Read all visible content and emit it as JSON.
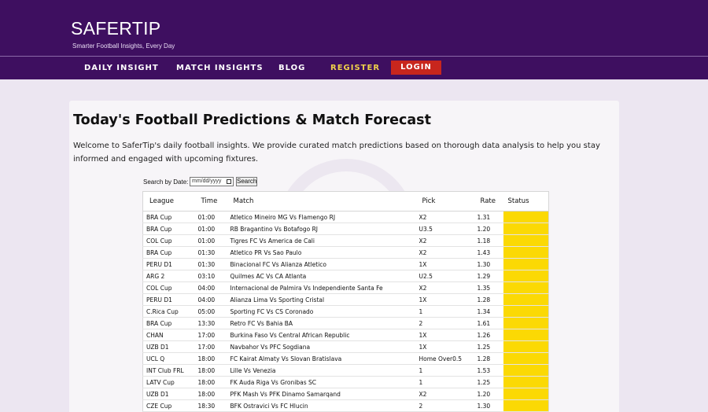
{
  "header": {
    "brand": "SAFERTIP",
    "tagline": "Smarter Football Insights, Every Day"
  },
  "nav": {
    "items": [
      "DAILY INSIGHT",
      "MATCH INSIGHTS",
      "BLOG",
      "REGISTER"
    ],
    "login": "LOGIN"
  },
  "main": {
    "title": "Today's Football Predictions & Match Forecast",
    "intro": "Welcome to SaferTip's daily football insights. We provide curated match predictions based on thorough data analysis to help you stay informed and engaged with upcoming fixtures."
  },
  "search": {
    "label": "Search by Date:",
    "date_placeholder": "mm/dd/yyyy",
    "button": "Search"
  },
  "table": {
    "headers": [
      "League",
      "Time",
      "Match",
      "Pick",
      "Rate",
      "Status"
    ],
    "status_color": "#fbd904",
    "rows": [
      [
        "BRA Cup",
        "01:00",
        "Atletico Mineiro MG Vs Flamengo RJ",
        "X2",
        "1.31",
        ""
      ],
      [
        "BRA Cup",
        "01:00",
        "RB Bragantino Vs Botafogo RJ",
        "U3.5",
        "1.20",
        ""
      ],
      [
        "COL Cup",
        "01:00",
        "Tigres FC Vs America de Cali",
        "X2",
        "1.18",
        ""
      ],
      [
        "BRA Cup",
        "01:30",
        "Atletico PR Vs Sao Paulo",
        "X2",
        "1.43",
        ""
      ],
      [
        "PERU D1",
        "01:30",
        "Binacional FC Vs Alianza Atletico",
        "1X",
        "1.30",
        ""
      ],
      [
        "ARG 2",
        "03:10",
        "Quilmes AC Vs CA Atlanta",
        "U2.5",
        "1.29",
        ""
      ],
      [
        "COL Cup",
        "04:00",
        "Internacional de Palmira Vs Independiente Santa Fe",
        "X2",
        "1.35",
        ""
      ],
      [
        "PERU D1",
        "04:00",
        "Alianza Lima Vs Sporting Cristal",
        "1X",
        "1.28",
        ""
      ],
      [
        "C.Rica Cup",
        "05:00",
        "Sporting FC Vs CS Coronado",
        "1",
        "1.34",
        ""
      ],
      [
        "BRA Cup",
        "13:30",
        "Retro FC Vs Bahia BA",
        "2",
        "1.61",
        ""
      ],
      [
        "CHAN",
        "17:00",
        "Burkina Faso Vs Central African Republic",
        "1X",
        "1.26",
        ""
      ],
      [
        "UZB D1",
        "17:00",
        "Navbahor Vs PFC Sogdiana",
        "1X",
        "1.25",
        ""
      ],
      [
        "UCL Q",
        "18:00",
        "FC Kairat Almaty Vs Slovan Bratislava",
        "Home Over0.5",
        "1.28",
        ""
      ],
      [
        "INT Club FRL",
        "18:00",
        "Lille Vs Venezia",
        "1",
        "1.53",
        ""
      ],
      [
        "LATV Cup",
        "18:00",
        "FK Auda Riga Vs Gronibas SC",
        "1",
        "1.25",
        ""
      ],
      [
        "UZB D1",
        "18:00",
        "PFK Mash Vs PFK Dinamo Samarqand",
        "X2",
        "1.20",
        ""
      ],
      [
        "CZE Cup",
        "18:30",
        "BFK Ostravici Vs FC Hlucin",
        "2",
        "1.30",
        ""
      ]
    ]
  }
}
